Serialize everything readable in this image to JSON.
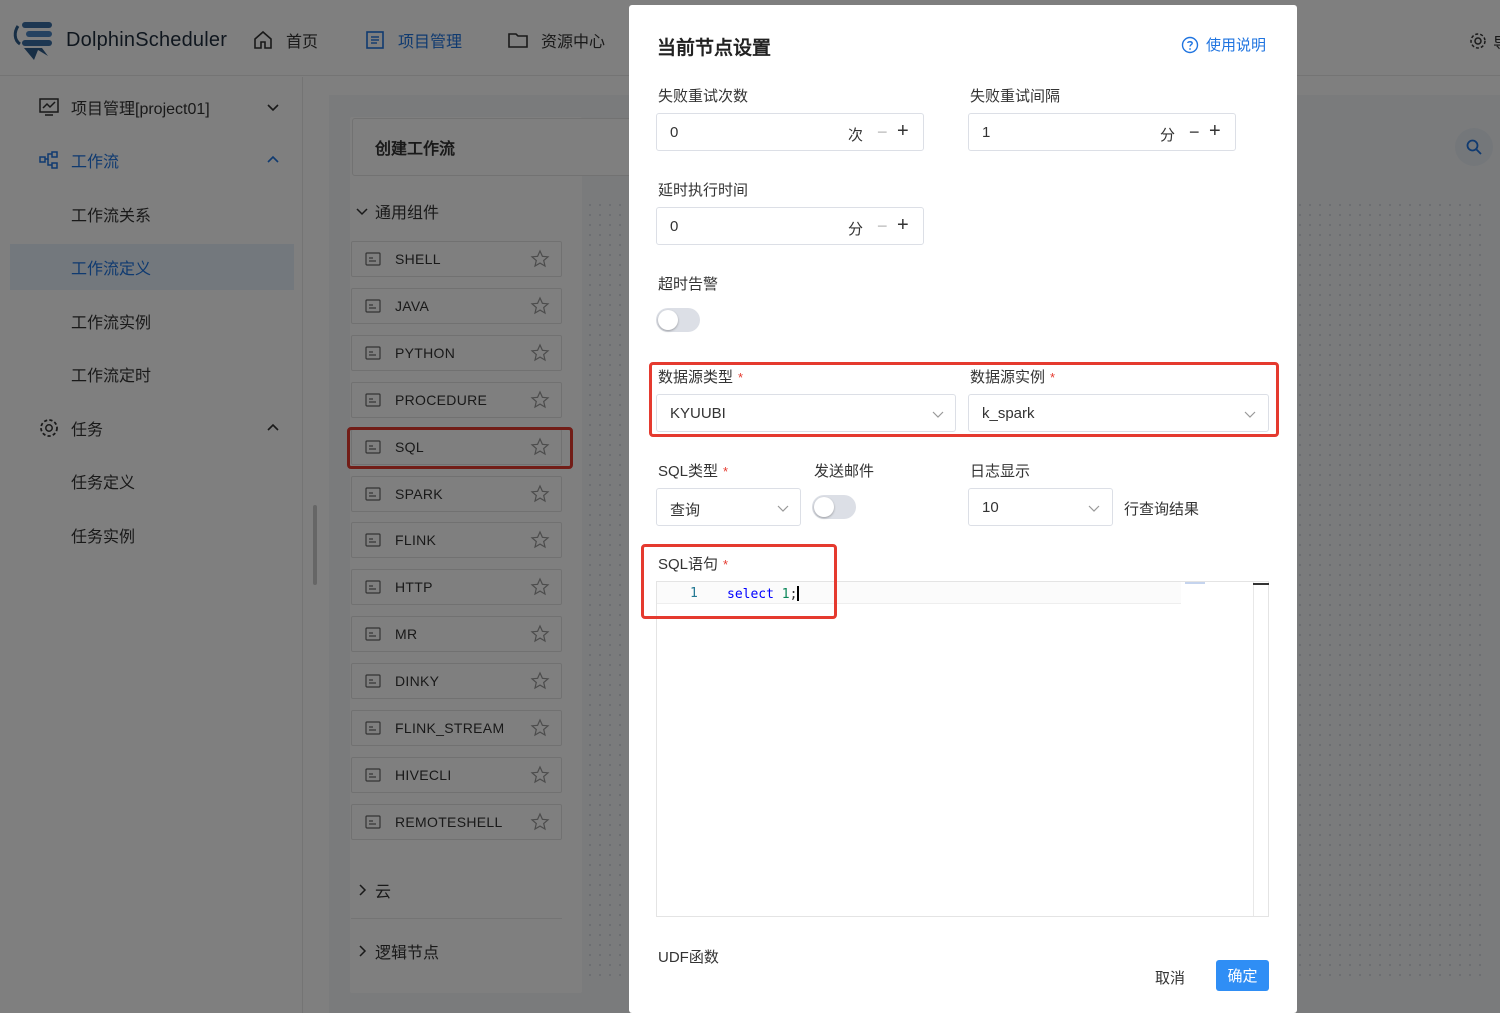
{
  "app": {
    "name": "DolphinScheduler",
    "nav": [
      {
        "label": "首页",
        "icon": "home-icon"
      },
      {
        "label": "项目管理",
        "icon": "project-icon",
        "active": true
      },
      {
        "label": "资源中心",
        "icon": "folder-icon"
      }
    ],
    "top_right_cut": "导"
  },
  "sidebar": {
    "project": "项目管理[project01]",
    "workflow": "工作流",
    "workflow_items": [
      "工作流关系",
      "工作流定义",
      "工作流实例",
      "工作流定时"
    ],
    "task": "任务",
    "task_items": [
      "任务定义",
      "任务实例"
    ]
  },
  "palette": {
    "create_title": "创建工作流",
    "group_general": "通用组件",
    "components": [
      "SHELL",
      "JAVA",
      "PYTHON",
      "PROCEDURE",
      "SQL",
      "SPARK",
      "FLINK",
      "HTTP",
      "MR",
      "DINKY",
      "FLINK_STREAM",
      "HIVECLI",
      "REMOTESHELL"
    ],
    "group_cloud": "云",
    "group_logic": "逻辑节点"
  },
  "modal": {
    "title": "当前节点设置",
    "help": "使用说明",
    "retry_times": {
      "label": "失败重试次数",
      "value": "0",
      "unit": "次"
    },
    "retry_interval": {
      "label": "失败重试间隔",
      "value": "1",
      "unit": "分"
    },
    "delay": {
      "label": "延时执行时间",
      "value": "0",
      "unit": "分"
    },
    "timeout_alarm": {
      "label": "超时告警",
      "on": false
    },
    "datasource_type": {
      "label": "数据源类型",
      "value": "KYUUBI"
    },
    "datasource_instance": {
      "label": "数据源实例",
      "value": "k_spark"
    },
    "sql_type": {
      "label": "SQL类型",
      "value": "查询"
    },
    "send_mail": {
      "label": "发送邮件",
      "on": false
    },
    "log_display": {
      "label": "日志显示",
      "value": "10",
      "suffix": "行查询结果"
    },
    "sql": {
      "label": "SQL语句",
      "line_no": "1",
      "keyword": "select",
      "number": "1",
      "punct": ";"
    },
    "udf": "UDF函数",
    "cancel": "取消",
    "confirm": "确定"
  },
  "colors": {
    "accent": "#1f74e0",
    "highlight": "#e53a2f",
    "button": "#2f8ef5"
  }
}
